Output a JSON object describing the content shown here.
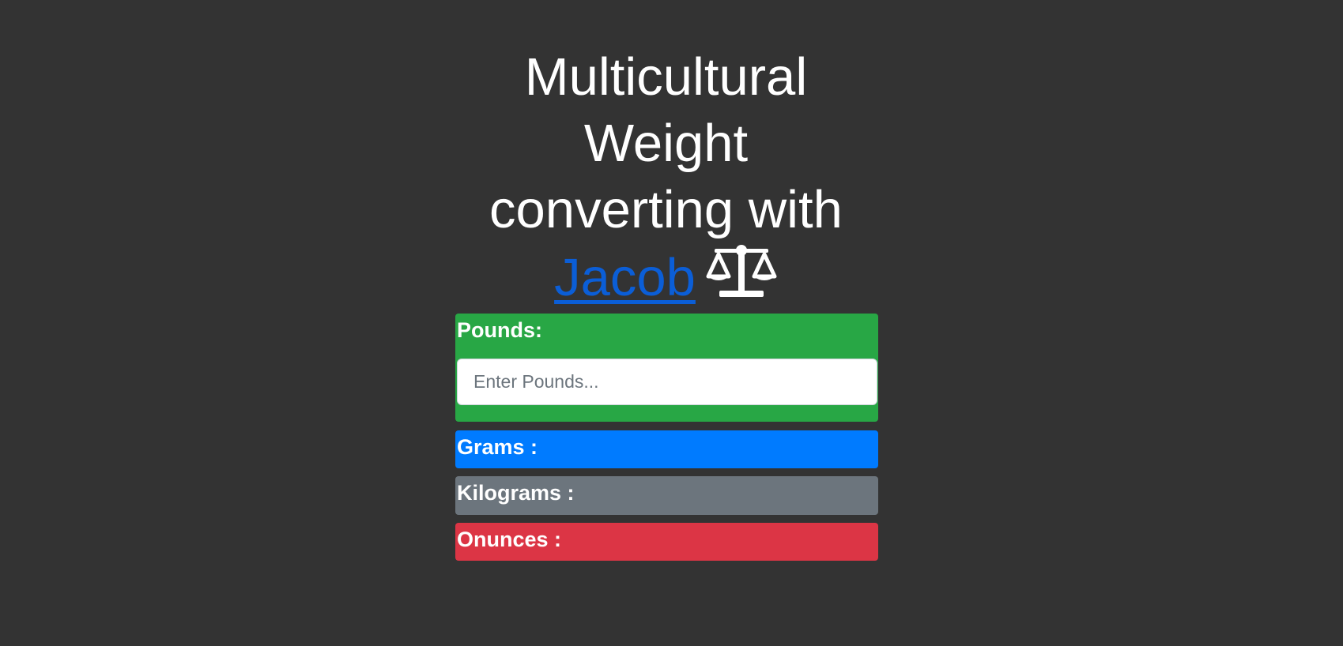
{
  "header": {
    "title_line1": "Multicultural",
    "title_line2": "Weight",
    "title_line3": "converting with",
    "author_link": "Jacob",
    "icon": "balance-scale-icon"
  },
  "converter": {
    "pounds": {
      "label": "Pounds:",
      "input_value": "",
      "input_placeholder": "Enter Pounds...",
      "color": "#28a745"
    },
    "grams": {
      "label": "Grams :",
      "value": "",
      "color": "#007bff"
    },
    "kilograms": {
      "label": "Kilograms :",
      "value": "",
      "color": "#6c757d"
    },
    "ounces": {
      "label": "Onunces :",
      "value": "",
      "color": "#dc3545"
    }
  },
  "colors": {
    "background": "#333333",
    "link": "#0b5ed7",
    "text": "#ffffff"
  }
}
